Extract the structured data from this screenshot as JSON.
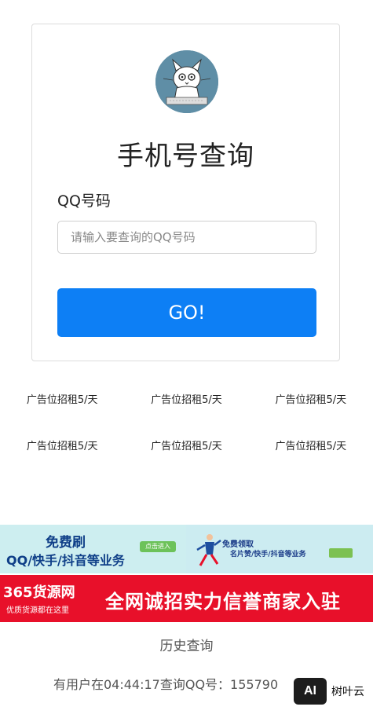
{
  "form": {
    "title": "手机号查询",
    "field_label": "QQ号码",
    "input_placeholder": "请输入要查询的QQ号码",
    "input_value": "",
    "submit_label": "GO!"
  },
  "ads": {
    "rows": [
      [
        "广告位招租5/天",
        "广告位招租5/天",
        "广告位招租5/天"
      ],
      [
        "广告位招租5/天",
        "广告位招租5/天",
        "广告位招租5/天"
      ]
    ]
  },
  "banner_top": {
    "left_line1": "免费刷",
    "left_line2": "QQ/快手/抖音等业务",
    "left_button": "点击进入",
    "right_line1": "免费领取",
    "right_line2": "名片赞/快手/抖音等业务"
  },
  "banner_bottom": {
    "brand": "365货源网",
    "tagline": "优质货源都在这里",
    "slogan": "全网诚招实力信誉商家入驻"
  },
  "history": {
    "title": "历史查询",
    "entry": "有用户在04:44:17查询QQ号：155790"
  },
  "watermark": {
    "logo": "AI",
    "text": "树叶云"
  },
  "colors": {
    "accent": "#0d7ff5",
    "banner_red": "#e8102a",
    "banner_light": "#cdeef0"
  }
}
